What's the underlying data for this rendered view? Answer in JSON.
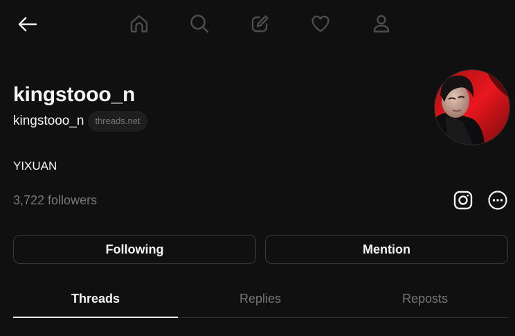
{
  "nav": {
    "back_icon": "arrow-left-icon",
    "items": [
      {
        "icon": "home-icon"
      },
      {
        "icon": "search-icon"
      },
      {
        "icon": "compose-icon"
      },
      {
        "icon": "heart-icon"
      },
      {
        "icon": "profile-icon"
      }
    ]
  },
  "profile": {
    "display_name": "kingstooo_n",
    "username": "kingstooo_n",
    "domain_badge": "threads.net",
    "bio": "YIXUAN",
    "followers": "3,722 followers",
    "avatar": "profile-photo"
  },
  "actions": {
    "following_label": "Following",
    "mention_label": "Mention",
    "instagram_icon": "instagram-icon",
    "more_icon": "more-icon"
  },
  "tabs": [
    {
      "label": "Threads",
      "active": true
    },
    {
      "label": "Replies",
      "active": false
    },
    {
      "label": "Reposts",
      "active": false
    }
  ],
  "colors": {
    "background": "#101010",
    "text_primary": "#f3f5f7",
    "text_secondary": "#777777",
    "border": "#3a3a3a"
  }
}
